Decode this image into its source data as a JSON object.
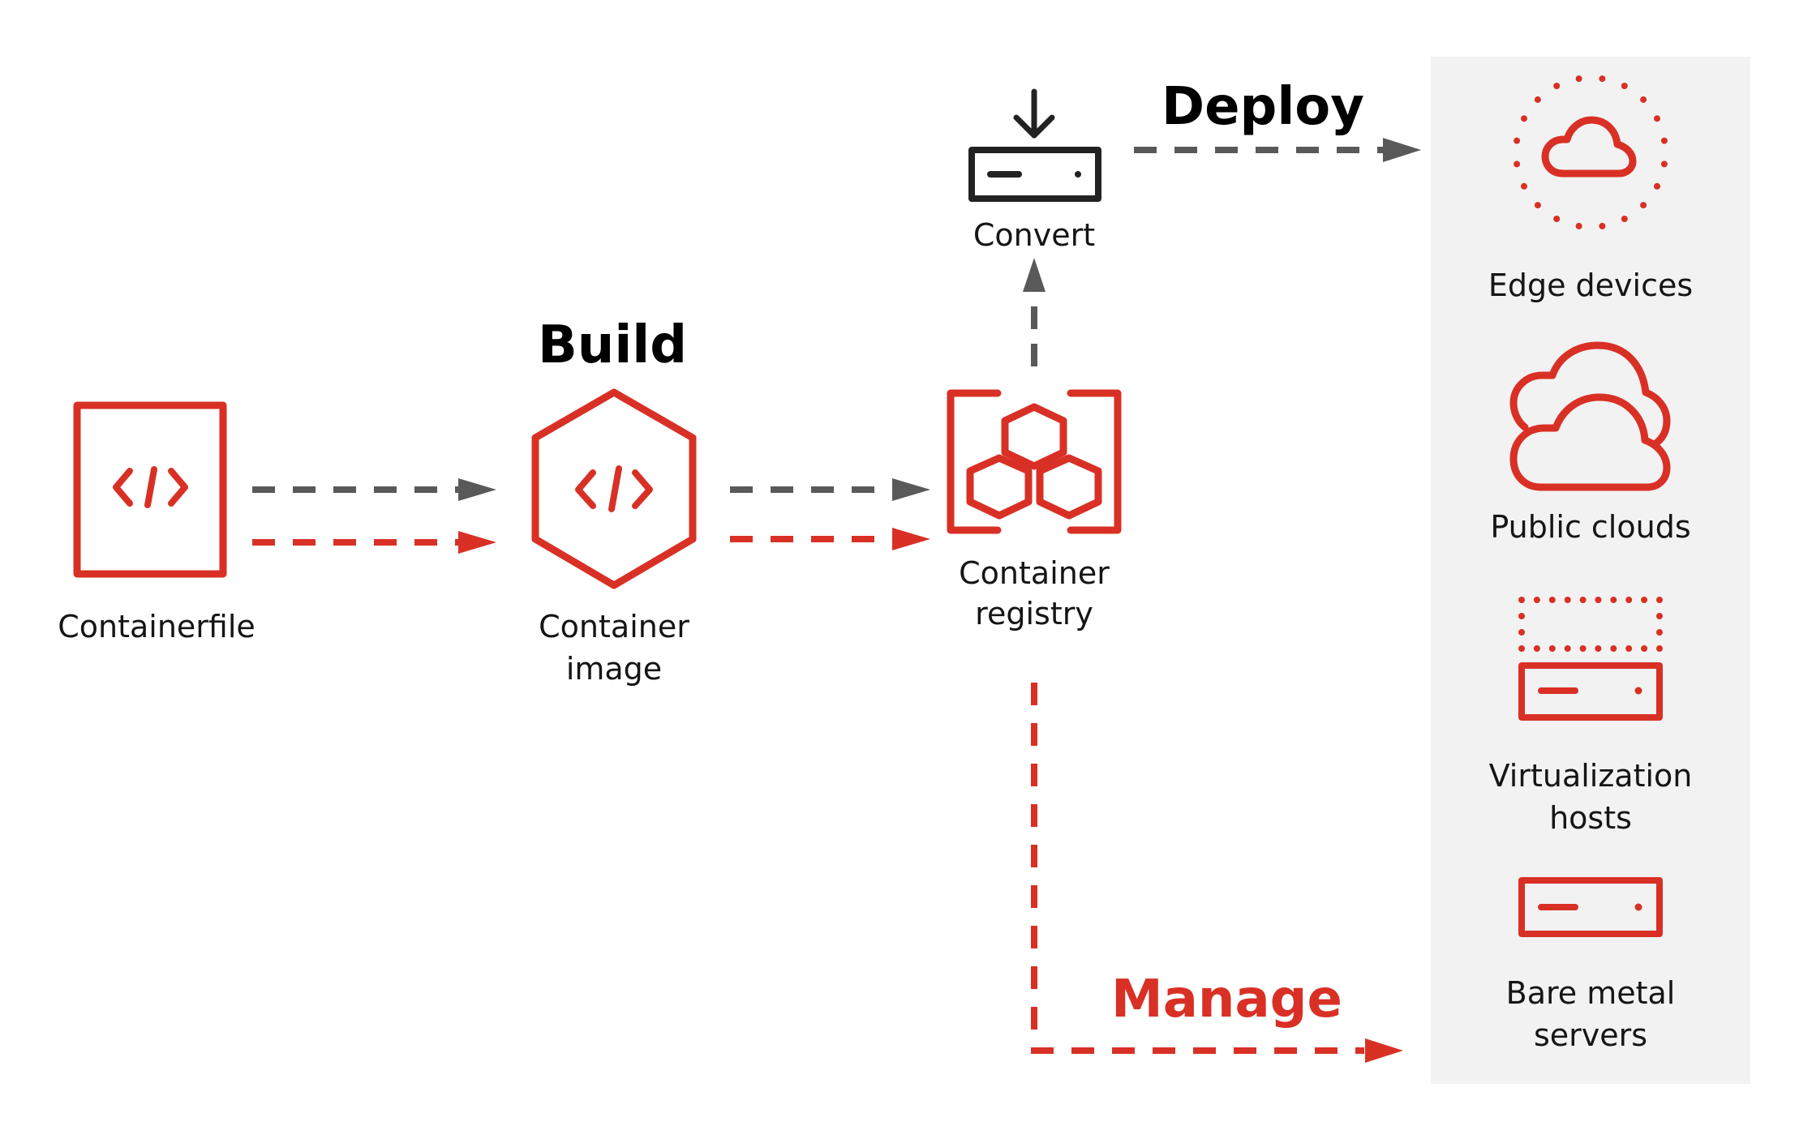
{
  "colors": {
    "accent": "#d93025",
    "neutral_arrow": "#595959",
    "panel_bg": "#f2f2f2",
    "text": "#151515",
    "icon_dark": "#222222"
  },
  "stages": {
    "build": "Build",
    "deploy": "Deploy",
    "manage": "Manage"
  },
  "nodes": {
    "containerfile": {
      "label": "Containerfile",
      "icon": "code-file-icon"
    },
    "container_image": {
      "label_line1": "Container",
      "label_line2": "image",
      "icon": "code-hexagon-icon"
    },
    "container_registry": {
      "label_line1": "Container",
      "label_line2": "registry",
      "icon": "registry-hexagons-icon"
    },
    "convert": {
      "label": "Convert",
      "icon": "download-server-icon"
    }
  },
  "targets": [
    {
      "label_line1": "Edge devices",
      "label_line2": "",
      "icon": "edge-cloud-icon"
    },
    {
      "label_line1": "Public clouds",
      "label_line2": "",
      "icon": "public-clouds-icon"
    },
    {
      "label_line1": "Virtualization",
      "label_line2": "hosts",
      "icon": "virtual-server-icon"
    },
    {
      "label_line1": "Bare metal",
      "label_line2": "servers",
      "icon": "bare-metal-server-icon"
    }
  ],
  "edges": [
    {
      "from": "Containerfile",
      "to": "Container image",
      "style": "gray-dashed"
    },
    {
      "from": "Containerfile",
      "to": "Container image",
      "style": "red-dashed"
    },
    {
      "from": "Container image",
      "to": "Container registry",
      "style": "gray-dashed"
    },
    {
      "from": "Container image",
      "to": "Container registry",
      "style": "red-dashed"
    },
    {
      "from": "Container registry",
      "to": "Convert",
      "style": "gray-dashed"
    },
    {
      "from": "Convert",
      "to": "Targets",
      "style": "gray-dashed",
      "stage": "Deploy"
    },
    {
      "from": "Container registry",
      "to": "Targets",
      "style": "red-dashed",
      "stage": "Manage"
    }
  ]
}
